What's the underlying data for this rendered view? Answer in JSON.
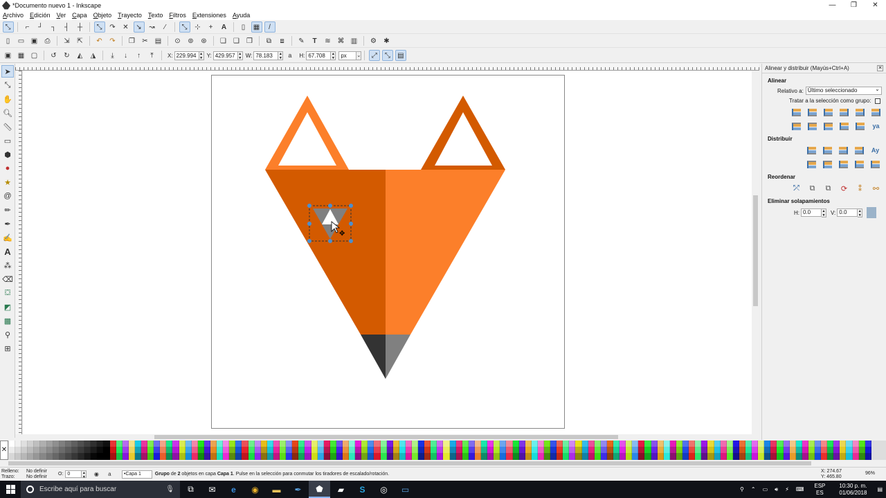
{
  "window": {
    "title": "*Documento nuevo 1 - Inkscape",
    "controls": [
      "—",
      "❐",
      "✕"
    ]
  },
  "menu": [
    "Archivo",
    "Edición",
    "Ver",
    "Capa",
    "Objeto",
    "Trayecto",
    "Texto",
    "Filtros",
    "Extensiones",
    "Ayuda"
  ],
  "select_toolbar": {
    "x_label": "X:",
    "x_value": "229.994",
    "y_label": "Y:",
    "y_value": "429.957",
    "w_label": "W:",
    "w_value": "78.183",
    "h_label": "H:",
    "h_value": "67.708",
    "unit": "px",
    "lock_icon": "lock-icon"
  },
  "dock": {
    "title": "Alinear y distribuir (Mayús+Ctrl+A)",
    "align_heading": "Alinear",
    "relative_label": "Relativo a:",
    "relative_value": "Último seleccionado",
    "treat_group_label": "Tratar a la selección como grupo:",
    "distribute_heading": "Distribuir",
    "reorder_heading": "Reordenar",
    "overlap_heading": "Eliminar solapamientos",
    "h_label": "H:",
    "h_value": "0.0",
    "v_label": "V:",
    "v_value": "0.0"
  },
  "status": {
    "fill_label": "Relleno:",
    "fill_value": "No definir",
    "stroke_label": "Trazo:",
    "stroke_value": "No definir",
    "opacity_label": "O:",
    "opacity_value": "0",
    "layer": "•Capa 1",
    "msg_a": "Grupo",
    "msg_b": " de ",
    "msg_c": "2",
    "msg_d": " objetos en capa ",
    "msg_e": "Capa 1",
    "msg_f": ". Pulse en la selección para conmutar los tiradores de escalado/rotación.",
    "cursor_x": "X: 274.67",
    "cursor_y": "Y: 465.80",
    "zoom": "96%"
  },
  "taskbar": {
    "search_placeholder": "Escribe aquí para buscar",
    "lang1": "ESP",
    "lang2": "ES",
    "time": "10:30 p. m.",
    "date": "01/06/2018"
  },
  "colors": {
    "fox_light": "#fc7f2a",
    "fox_dark": "#d35a00",
    "nose_dark": "#333333",
    "nose_light": "#808080",
    "eye_white": "#ffffff",
    "selection": "#4a8fd0",
    "accent": "#3d6fa6"
  }
}
